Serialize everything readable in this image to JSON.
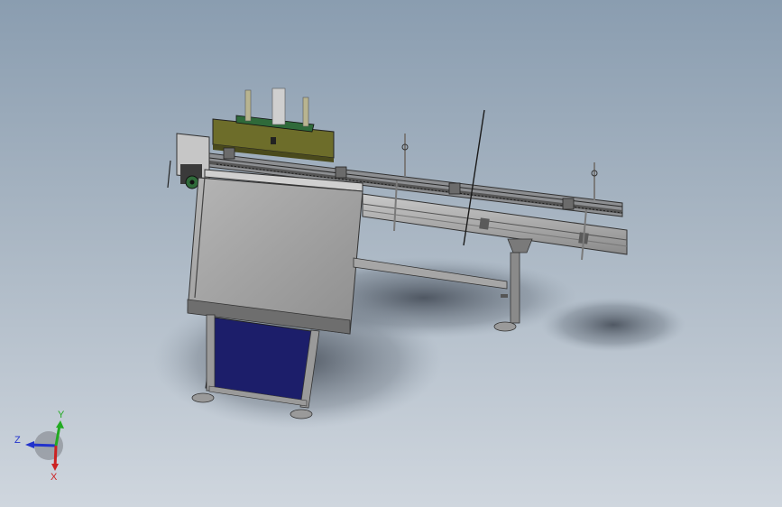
{
  "viewport": {
    "background_top": "#8a9db0",
    "background_bottom": "#cfd6de"
  },
  "model": {
    "frame_color": "#9a9a9a",
    "panel_color": "#9c9c9c",
    "blue_panel_color": "#1c1e6a",
    "olive_color": "#6d6d2a",
    "green_color": "#2f6a3a"
  },
  "triad": {
    "y_label": "Y",
    "z_label": "Z",
    "x_label": "X",
    "y_color": "#22aa22",
    "z_color": "#2233cc",
    "x_color": "#cc2222"
  }
}
